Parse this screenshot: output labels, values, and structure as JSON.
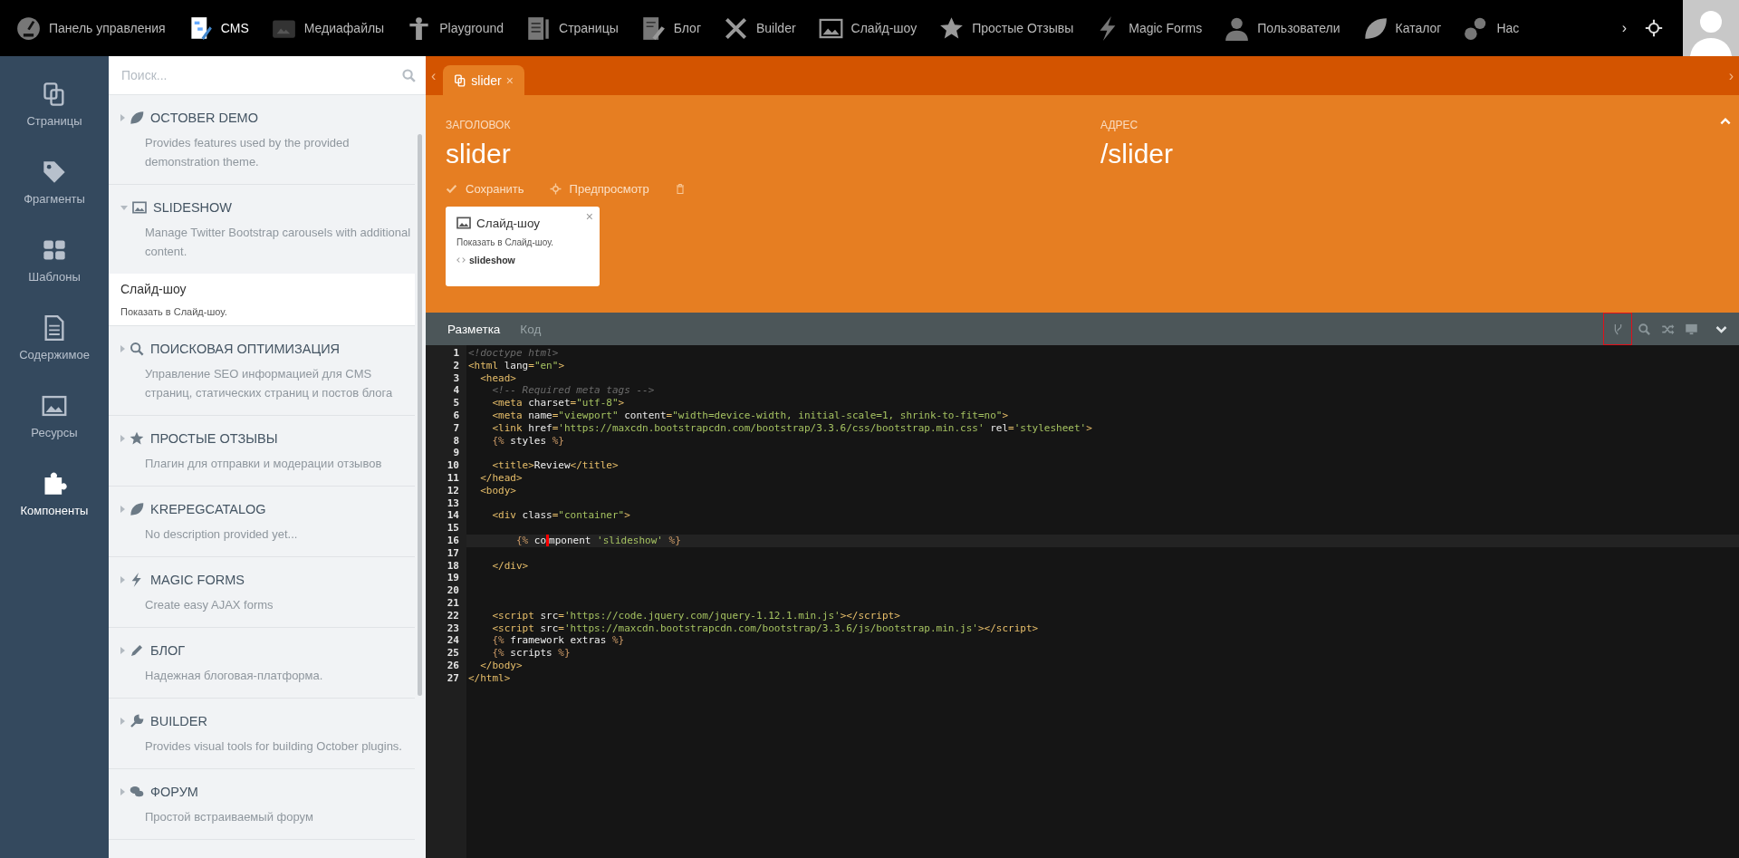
{
  "top_nav": {
    "items": [
      {
        "label": "Панель управления",
        "selected": false
      },
      {
        "label": "CMS",
        "selected": true
      },
      {
        "label": "Медиафайлы",
        "selected": false
      },
      {
        "label": "Playground",
        "selected": false
      },
      {
        "label": "Страницы",
        "selected": false
      },
      {
        "label": "Блог",
        "selected": false
      },
      {
        "label": "Builder",
        "selected": false
      },
      {
        "label": "Слайд-шоу",
        "selected": false
      },
      {
        "label": "Простые Отзывы",
        "selected": false
      },
      {
        "label": "Magic Forms",
        "selected": false
      },
      {
        "label": "Пользователи",
        "selected": false
      },
      {
        "label": "Каталог",
        "selected": false
      },
      {
        "label": "Нас",
        "selected": false
      }
    ],
    "more": "›"
  },
  "sidebar": {
    "items": [
      {
        "label": "Страницы",
        "selected": false
      },
      {
        "label": "Фрагменты",
        "selected": false
      },
      {
        "label": "Шаблоны",
        "selected": false
      },
      {
        "label": "Содержимое",
        "selected": false
      },
      {
        "label": "Ресурсы",
        "selected": false
      },
      {
        "label": "Компоненты",
        "selected": true
      }
    ]
  },
  "components": {
    "search": {
      "placeholder": "Поиск..."
    },
    "groups": [
      {
        "title": "OCTOBER DEMO",
        "description": "Provides features used by the provided demonstration theme.",
        "expanded": false
      },
      {
        "title": "SLIDESHOW",
        "description": "Manage Twitter Bootstrap carousels with additional content.",
        "expanded": true,
        "children": [
          {
            "title": "Слайд-шоу",
            "description": "Показать в Слайд-шоу."
          }
        ]
      },
      {
        "title": "ПОИСКОВАЯ ОПТИМИЗАЦИЯ",
        "description": "Управление SEO информацией для CMS страниц, статических страниц и постов блога",
        "expanded": false
      },
      {
        "title": "ПРОСТЫЕ ОТЗЫВЫ",
        "description": "Плагин для отправки и модерации отзывов",
        "expanded": false
      },
      {
        "title": "KREPEGCATALOG",
        "description": "No description provided yet...",
        "expanded": false
      },
      {
        "title": "MAGIC FORMS",
        "description": "Create easy AJAX forms",
        "expanded": false
      },
      {
        "title": "БЛОГ",
        "description": "Надежная блоговая-платформа.",
        "expanded": false
      },
      {
        "title": "BUILDER",
        "description": "Provides visual tools for building October plugins.",
        "expanded": false
      },
      {
        "title": "ФОРУМ",
        "description": "Простой встраиваемый форум",
        "expanded": false
      }
    ]
  },
  "tabs": {
    "prev": "‹",
    "next": "›",
    "items": [
      {
        "label": "slider",
        "close": "×",
        "selected": true
      }
    ]
  },
  "page": {
    "fields": [
      {
        "label": "ЗАГОЛОВОК",
        "value": "slider"
      },
      {
        "label": "АДРЕС",
        "value": "/slider"
      }
    ],
    "actions": [
      "Сохранить",
      "Предпросмотр"
    ],
    "component_card": {
      "title": "Слайд-шоу",
      "description": "Показать в Слайд-шоу.",
      "alias": "slideshow",
      "close": "×"
    }
  },
  "editor": {
    "tabs": [
      {
        "label": "Разметка",
        "selected": true
      },
      {
        "label": "Код",
        "selected": false
      }
    ],
    "tools": [
      {
        "outlined": true
      },
      {
        "outlined": false
      },
      {
        "outlined": false
      },
      {
        "outlined": false
      },
      {
        "outlined": false
      }
    ],
    "lines": [
      {
        "number": "1",
        "active": false,
        "tokens": [
          {
            "kind": "comment",
            "text": "<!doctype html>"
          }
        ]
      },
      {
        "number": "2",
        "active": false,
        "tokens": [
          {
            "kind": "tag",
            "text": "<html "
          },
          {
            "kind": "attr",
            "text": "lang"
          },
          {
            "kind": "tag",
            "text": "="
          },
          {
            "kind": "string",
            "text": "\"en\""
          },
          {
            "kind": "tag",
            "text": ">"
          }
        ]
      },
      {
        "number": "3",
        "active": false,
        "tokens": [
          {
            "kind": "tag",
            "text": "  <head>"
          }
        ]
      },
      {
        "number": "4",
        "active": false,
        "tokens": [
          {
            "kind": "comment",
            "text": "    <!-- Required meta tags -->"
          }
        ]
      },
      {
        "number": "5",
        "active": false,
        "tokens": [
          {
            "kind": "tag",
            "text": "    <meta "
          },
          {
            "kind": "attr",
            "text": "charset"
          },
          {
            "kind": "tag",
            "text": "="
          },
          {
            "kind": "string",
            "text": "\"utf-8\""
          },
          {
            "kind": "tag",
            "text": ">"
          }
        ]
      },
      {
        "number": "6",
        "active": false,
        "tokens": [
          {
            "kind": "tag",
            "text": "    <meta "
          },
          {
            "kind": "attr",
            "text": "name"
          },
          {
            "kind": "tag",
            "text": "="
          },
          {
            "kind": "string",
            "text": "\"viewport\""
          },
          {
            "kind": "attr",
            "text": " content"
          },
          {
            "kind": "tag",
            "text": "="
          },
          {
            "kind": "string",
            "text": "\"width=device-width, initial-scale=1, shrink-to-fit=no\""
          },
          {
            "kind": "tag",
            "text": ">"
          }
        ]
      },
      {
        "number": "7",
        "active": false,
        "tokens": [
          {
            "kind": "tag",
            "text": "    <link "
          },
          {
            "kind": "attr",
            "text": "href"
          },
          {
            "kind": "tag",
            "text": "="
          },
          {
            "kind": "string",
            "text": "'https://maxcdn.bootstrapcdn.com/bootstrap/3.3.6/css/bootstrap.min.css'"
          },
          {
            "kind": "attr",
            "text": " rel"
          },
          {
            "kind": "tag",
            "text": "="
          },
          {
            "kind": "string",
            "text": "'stylesheet'"
          },
          {
            "kind": "tag",
            "text": ">"
          }
        ]
      },
      {
        "number": "8",
        "active": false,
        "tokens": [
          {
            "kind": "twig",
            "text": "    {% "
          },
          {
            "kind": "word",
            "text": "styles"
          },
          {
            "kind": "twig",
            "text": " %}"
          }
        ]
      },
      {
        "number": "9",
        "active": false
      },
      {
        "number": "10",
        "active": false,
        "tokens": [
          {
            "kind": "tag",
            "text": "    <title>"
          },
          {
            "kind": "word",
            "text": "Review"
          },
          {
            "kind": "tag",
            "text": "</title>"
          }
        ]
      },
      {
        "number": "11",
        "active": false,
        "tokens": [
          {
            "kind": "tag",
            "text": "  </head>"
          }
        ]
      },
      {
        "number": "12",
        "active": false,
        "tokens": [
          {
            "kind": "tag",
            "text": "  <body>"
          }
        ]
      },
      {
        "number": "13",
        "active": false
      },
      {
        "number": "14",
        "active": false,
        "tokens": [
          {
            "kind": "tag",
            "text": "    <div "
          },
          {
            "kind": "attr",
            "text": "class"
          },
          {
            "kind": "tag",
            "text": "="
          },
          {
            "kind": "string",
            "text": "\"container\""
          },
          {
            "kind": "tag",
            "text": ">"
          }
        ]
      },
      {
        "number": "15",
        "active": false
      },
      {
        "number": "16",
        "active": true,
        "tokens": [
          {
            "kind": "twig",
            "text": "        {% "
          },
          {
            "kind": "word",
            "text": "co"
          },
          {
            "kind": "word-at-cursor",
            "text": "mponent"
          },
          {
            "kind": "string",
            "text": " 'slideshow'"
          },
          {
            "kind": "twig",
            "text": " %}"
          }
        ]
      },
      {
        "number": "17",
        "active": false
      },
      {
        "number": "18",
        "active": false,
        "tokens": [
          {
            "kind": "tag",
            "text": "    </div>"
          }
        ]
      },
      {
        "number": "19",
        "active": false
      },
      {
        "number": "20",
        "active": false
      },
      {
        "number": "21",
        "active": false
      },
      {
        "number": "22",
        "active": false,
        "tokens": [
          {
            "kind": "tag",
            "text": "    <script "
          },
          {
            "kind": "attr",
            "text": "src"
          },
          {
            "kind": "tag",
            "text": "="
          },
          {
            "kind": "string",
            "text": "'https://code.jquery.com/jquery-1.12.1.min.js'"
          },
          {
            "kind": "tag",
            "text": "></script>"
          }
        ]
      },
      {
        "number": "23",
        "active": false,
        "tokens": [
          {
            "kind": "tag",
            "text": "    <script "
          },
          {
            "kind": "attr",
            "text": "src"
          },
          {
            "kind": "tag",
            "text": "="
          },
          {
            "kind": "string",
            "text": "'https://maxcdn.bootstrapcdn.com/bootstrap/3.3.6/js/bootstrap.min.js'"
          },
          {
            "kind": "tag",
            "text": "></script>"
          }
        ]
      },
      {
        "number": "24",
        "active": false,
        "tokens": [
          {
            "kind": "twig",
            "text": "    {% "
          },
          {
            "kind": "word",
            "text": "framework extras"
          },
          {
            "kind": "twig",
            "text": " %}"
          }
        ]
      },
      {
        "number": "25",
        "active": false,
        "tokens": [
          {
            "kind": "twig",
            "text": "    {% "
          },
          {
            "kind": "word",
            "text": "scripts"
          },
          {
            "kind": "twig",
            "text": " %}"
          }
        ]
      },
      {
        "number": "26",
        "active": false,
        "tokens": [
          {
            "kind": "tag",
            "text": "  </body>"
          }
        ]
      },
      {
        "number": "27",
        "active": false,
        "tokens": [
          {
            "kind": "tag",
            "text": "</html>"
          }
        ]
      }
    ]
  }
}
